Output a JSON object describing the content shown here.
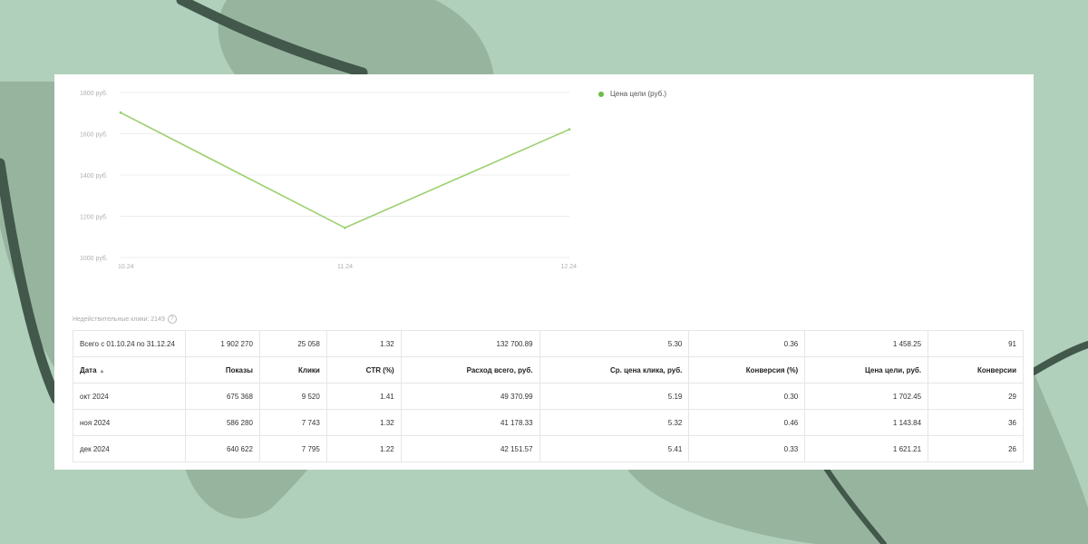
{
  "chart": {
    "legend": "Цена цели (руб.)",
    "y_ticks": [
      "1800 руб.",
      "1600 руб.",
      "1400 руб.",
      "1200 руб.",
      "1000 руб."
    ],
    "x_ticks": [
      "10.24",
      "11.24",
      "12.24"
    ]
  },
  "chart_data": {
    "type": "line",
    "x": [
      "10.24",
      "11.24",
      "12.24"
    ],
    "series": [
      {
        "name": "Цена цели (руб.)",
        "values": [
          1702.45,
          1143.84,
          1621.21
        ],
        "color": "#9bd06e"
      }
    ],
    "ylim": [
      1000,
      1800
    ],
    "y_tick_values": [
      1800,
      1600,
      1400,
      1200,
      1000
    ],
    "grid": true,
    "legend_position": "top-right"
  },
  "invalid_clicks": "Недействительные клики: 2149",
  "table": {
    "totals": [
      "Всего с 01.10.24 по 31.12.24",
      "1 902 270",
      "25 058",
      "1.32",
      "132 700.89",
      "5.30",
      "0.36",
      "1 458.25",
      "91"
    ],
    "headers": [
      "Дата",
      "Показы",
      "Клики",
      "CTR (%)",
      "Расход всего, руб.",
      "Ср. цена клика, руб.",
      "Конверсия (%)",
      "Цена цели, руб.",
      "Конверсии"
    ],
    "rows": [
      [
        "окт 2024",
        "675 368",
        "9 520",
        "1.41",
        "49 370.99",
        "5.19",
        "0.30",
        "1 702.45",
        "29"
      ],
      [
        "ноя 2024",
        "586 280",
        "7 743",
        "1.32",
        "41 178.33",
        "5.32",
        "0.46",
        "1 143.84",
        "36"
      ],
      [
        "дек 2024",
        "640 622",
        "7 795",
        "1.22",
        "42 151.57",
        "5.41",
        "0.33",
        "1 621.21",
        "26"
      ]
    ]
  },
  "colors": {
    "background": "#b0d0bc",
    "blob": "#97b49f",
    "stem": "#41584a",
    "line": "#9bd06e",
    "legend_dot": "#6dbb45"
  },
  "icons": {
    "help": "question-circle-icon",
    "sort": "sort-ascending-icon"
  }
}
